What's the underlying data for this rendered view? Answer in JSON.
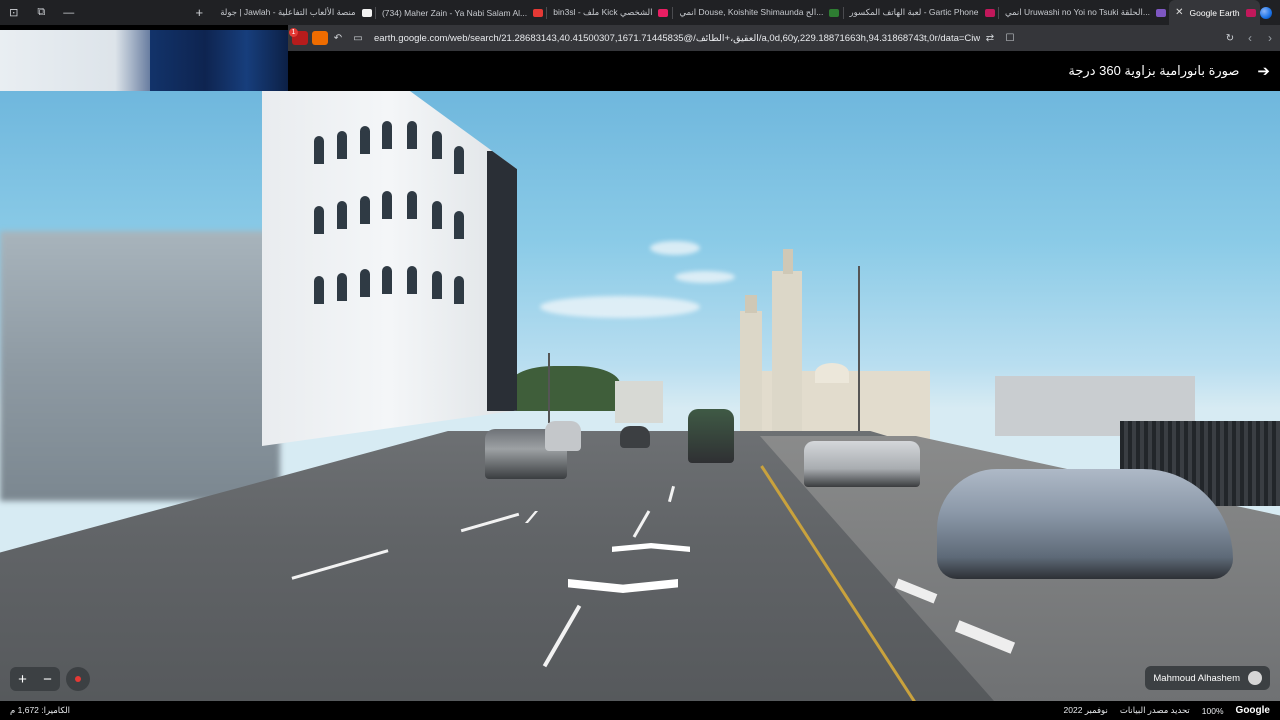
{
  "browser": {
    "tabs": [
      {
        "label": "جولة | Jawlah - منصة الألعاب التفاعلية",
        "favicon_color": "#f2f2f2"
      },
      {
        "label": "(734) Maher Zain - Ya Nabi Salam Al...",
        "favicon_color": "#e53935"
      },
      {
        "label": "bin3sl - ملف Kick الشخصي",
        "favicon_color": "#e91e63"
      },
      {
        "label": "انمي Douse, Koishite Shimaunda الح...",
        "favicon_color": "#2e7d32"
      },
      {
        "label": "لعبة الهاتف المكسور - Gartic Phone",
        "favicon_color": "#c2185b"
      },
      {
        "label": "انمي Uruwashi no Yoi no Tsuki الحلقة...",
        "favicon_color": "#7e57c2"
      },
      {
        "label": "Google Earth",
        "favicon_color": "#c2185b",
        "active": true
      }
    ],
    "new_tab_label": "+",
    "url": "earth.google.com/web/search/21.28683143,40.41500307,1671.71445835@/العقيق،+الطائف/a,0d,60y,229.18871663h,94.31868743t,0r/data=CiwiJ...",
    "notification_badge": "1"
  },
  "panorama": {
    "title": "صورة بانورامية بزاوية 360 درجة",
    "author": "Mahmoud Alhashem"
  },
  "controls": {
    "zoom_in": "+",
    "zoom_out": "−"
  },
  "status_bar": {
    "camera": "الكاميرا: 1,672 م",
    "date": "نوفمبر 2022",
    "data_source": "تحديد مصدر البيانات",
    "zoom": "100%",
    "brand": "Google"
  }
}
